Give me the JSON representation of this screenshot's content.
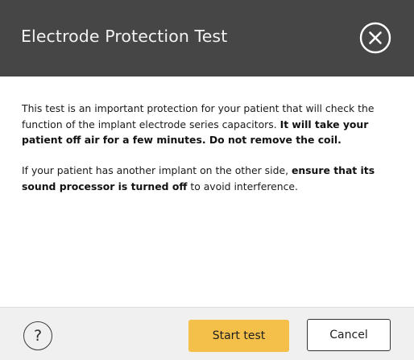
{
  "dialog": {
    "title": "Electrode Protection Test",
    "close_icon": "close-circle-icon",
    "header_color": "#464646"
  },
  "body": {
    "paragraph1": {
      "normal": "This test is an important protection for your patient that will check the function of the implant electrode series capacitors. ",
      "bold": "It will take your patient off air for a few minutes. Do not remove the coil."
    },
    "paragraph2": {
      "normal_start": "If your patient has another implant on the other side, ",
      "bold": "ensure that its sound processor is turned off",
      "normal_end": " to avoid interference."
    }
  },
  "footer": {
    "help_label": "?",
    "help_icon": "help-icon",
    "start_label": "Start test",
    "cancel_label": "Cancel",
    "start_color": "#f4c04a"
  }
}
